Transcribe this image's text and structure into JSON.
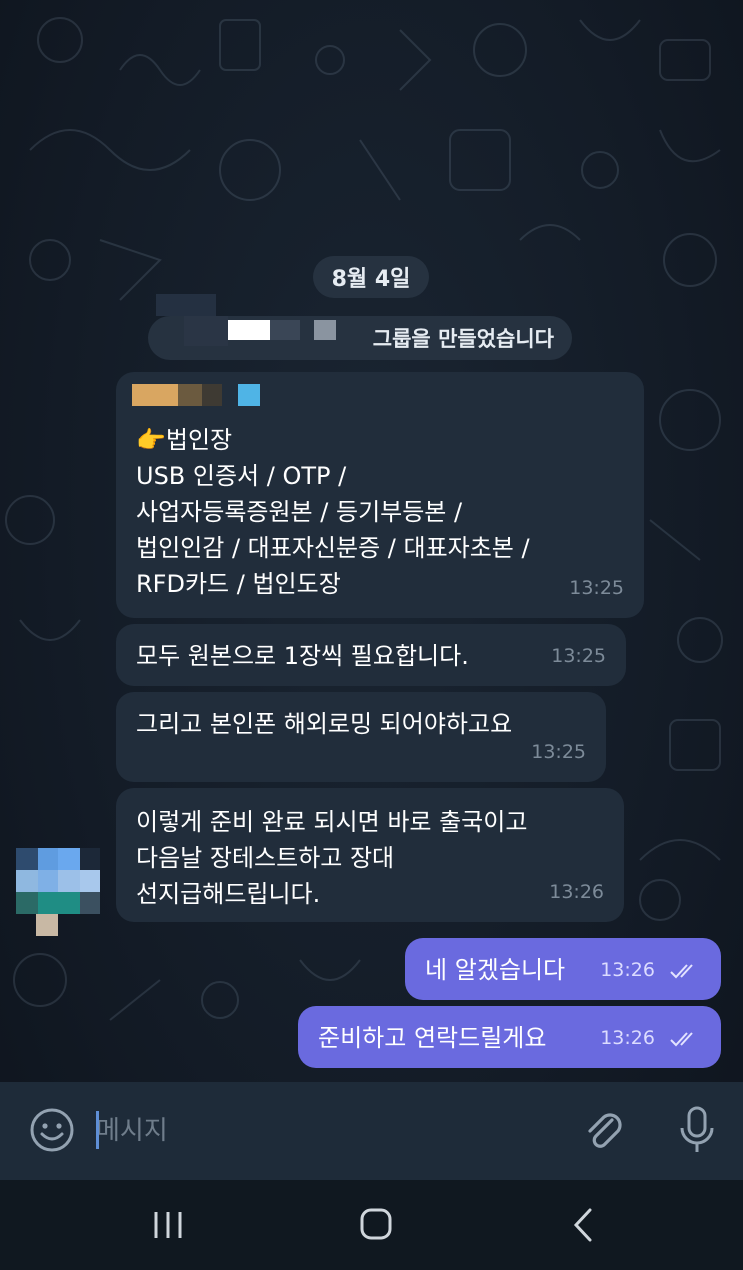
{
  "chat": {
    "date_label": "8월 4일",
    "service_message": "그룹을 만들었습니다",
    "messages": [
      {
        "direction": "in",
        "text": "👉법인장\nUSB 인증서 / OTP /\n사업자등록증원본 / 등기부등본 /\n법인인감 / 대표자신분증 / 대표자초본 /\nRFD카드 / 법인도장",
        "time": "13:25"
      },
      {
        "direction": "in",
        "text": "모두 원본으로 1장씩 필요합니다.",
        "time": "13:25"
      },
      {
        "direction": "in",
        "text": "그리고 본인폰 해외로밍 되어야하고요",
        "time": "13:25"
      },
      {
        "direction": "in",
        "text": "이렇게 준비 완료 되시면 바로 출국이고\n다음날 장테스트하고 장대\n선지급해드립니다.",
        "time": "13:26"
      },
      {
        "direction": "out",
        "text": "네 알겠습니다",
        "time": "13:26",
        "status": "read"
      },
      {
        "direction": "out",
        "text": "준비하고 연락드릴게요",
        "time": "13:26",
        "status": "read"
      }
    ]
  },
  "composer": {
    "placeholder": "메시지",
    "emoji_icon": "smile-icon",
    "attach_icon": "paperclip-icon",
    "mic_icon": "microphone-icon"
  },
  "navigation": {
    "recents_icon": "recents-icon",
    "home_icon": "home-icon",
    "back_icon": "back-icon"
  },
  "colors": {
    "incoming_bubble": "#212d3b",
    "outgoing_bubble": "#6a6adf",
    "background": "#131b26",
    "input_bar": "#1e2b39"
  }
}
